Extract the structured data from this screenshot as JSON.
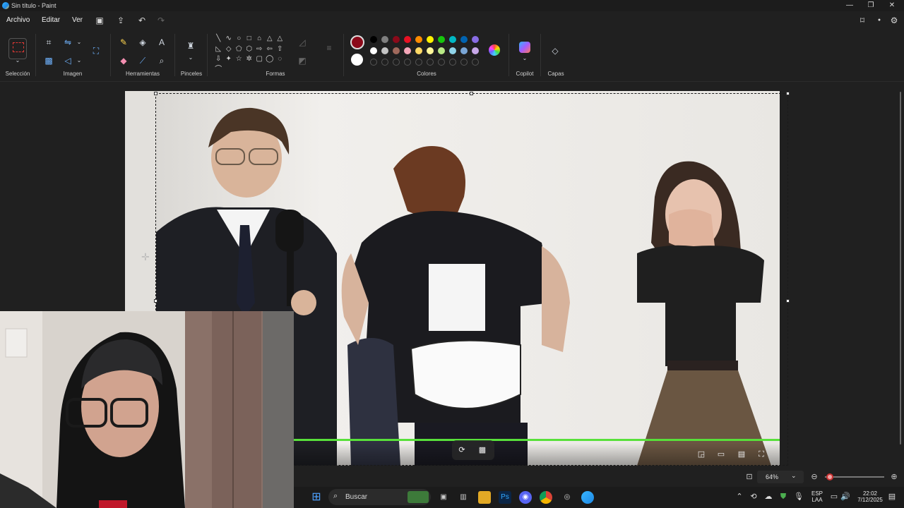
{
  "window": {
    "title": "Sin título - Paint",
    "controls": {
      "minimize": "—",
      "maximize": "❐",
      "close": "✕"
    }
  },
  "menu": {
    "items": [
      "Archivo",
      "Editar",
      "Ver"
    ],
    "quick_access_icons": [
      "save-icon",
      "share-icon",
      "undo-icon",
      "redo-icon"
    ],
    "right_icons": [
      "feedback-icon",
      "account-icon",
      "settings-icon"
    ]
  },
  "ribbon": {
    "groups": {
      "seleccion": "Selección",
      "imagen": "Imagen",
      "herramientas": "Herramientas",
      "pinceles": "Pinceles",
      "formas": "Formas",
      "colores": "Colores",
      "copilot": "Copilot",
      "capas": "Capas"
    },
    "shapes": [
      "╲",
      "∿",
      "○",
      "□",
      "⌂",
      "△",
      "△",
      "◺",
      "◇",
      "⬠",
      "⬡",
      "⇨",
      "⇦",
      "⇧",
      "⇩",
      "✦",
      "☆",
      "✲",
      "▢",
      "◯",
      "◌",
      "⌒"
    ],
    "colors": {
      "primary": "#8b0a1a",
      "secondary": "#ffffff",
      "row1": [
        "#000000",
        "#7f7f7f",
        "#8b0a1a",
        "#e81123",
        "#ff8c00",
        "#fff100",
        "#16c60c",
        "#00b7c3",
        "#0063b1",
        "#886ce4"
      ],
      "row2": [
        "#ffffff",
        "#c3c3c3",
        "#a0695c",
        "#f4a6b8",
        "#ffd966",
        "#fff79a",
        "#b8e986",
        "#8fd3e8",
        "#7aa6d6",
        "#c8a8e9"
      ]
    }
  },
  "canvas": {
    "subjects": [
      "man-in-suit-with-microphone",
      "person-in-maid-costume",
      "woman-covering-mouth"
    ],
    "overlay_controls": [
      "rotate-icon",
      "filter-icon",
      "pip-icon",
      "cast-icon",
      "subtitle-icon",
      "fullscreen-icon"
    ]
  },
  "statusbar": {
    "zoom": "64%",
    "zoom_level": 0.08
  },
  "taskbar": {
    "search": "Buscar",
    "apps": [
      "start-icon",
      "search-icon",
      "widgets-icon",
      "task-view-icon",
      "notepad-icon",
      "file-explorer-icon",
      "photoshop-icon",
      "discord-icon",
      "chrome-icon",
      "app-icon",
      "paint-icon"
    ],
    "photoshop_label": "Ps",
    "language_top": "ESP",
    "language_bottom": "LAA",
    "time": "22:02",
    "date": "7/12/2025"
  }
}
